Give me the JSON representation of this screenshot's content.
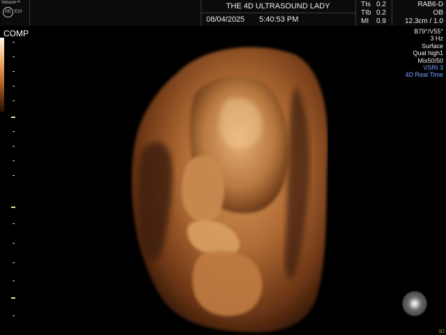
{
  "header": {
    "brand": "Voluson™",
    "model": "E10",
    "logo_text": "GE",
    "title": "THE 4D ULTRASOUND LADY",
    "date": "08/04/2025",
    "time": "5:40:53 PM",
    "indices": [
      {
        "label": "TIs",
        "value": "0.2"
      },
      {
        "label": "TIb",
        "value": "0.2"
      },
      {
        "label": "MI",
        "value": "0.9"
      }
    ],
    "probe": "RAB6-D",
    "preset": "OB",
    "depth": "12.3cm / 1.0"
  },
  "overlay": {
    "comp_label": "COMP",
    "params": [
      "B79°/V55°",
      "3 Hz",
      "Surface",
      "Qual high1",
      "Mix50/50"
    ],
    "params_highlight": [
      "VSRI 3",
      "4D Real Time"
    ],
    "corner_label": "3D"
  },
  "colors": {
    "background": "#000000",
    "highlight_text": "#7aa0ff",
    "render_tone": "#b9733a"
  },
  "icons": {
    "render_orb": "sphere-orientation-icon",
    "logo": "ge-logo-icon"
  }
}
